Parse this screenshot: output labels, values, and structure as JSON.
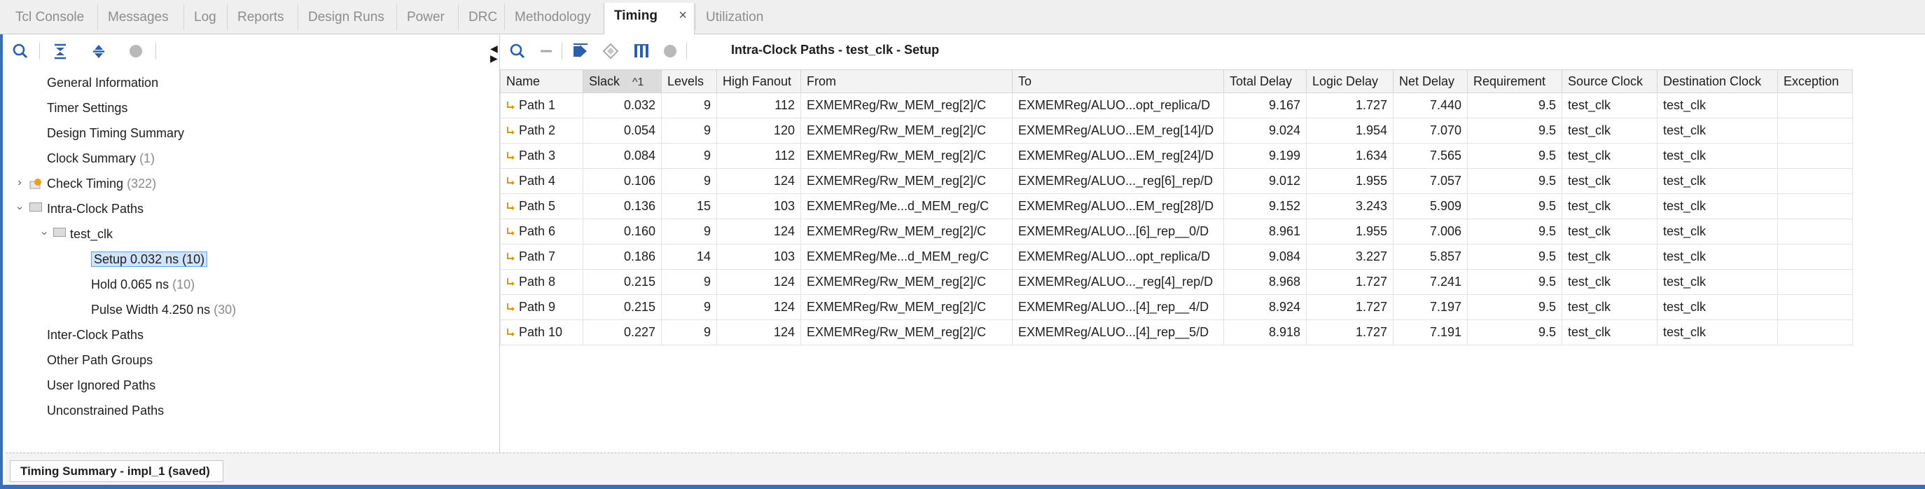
{
  "tabs": [
    {
      "label": "Tcl Console"
    },
    {
      "label": "Messages"
    },
    {
      "label": "Log"
    },
    {
      "label": "Reports"
    },
    {
      "label": "Design Runs"
    },
    {
      "label": "Power"
    },
    {
      "label": "DRC"
    },
    {
      "label": "Methodology"
    },
    {
      "label": "Timing",
      "close": "×"
    },
    {
      "label": "Utilization"
    }
  ],
  "left_toolbar": {
    "icons": [
      "search-icon",
      "collapse-all-icon",
      "expand-all-icon",
      "stop-icon"
    ]
  },
  "tree": {
    "general_info": "General Information",
    "timer_settings": "Timer Settings",
    "design_timing_summary": "Design Timing Summary",
    "clock_summary": {
      "label": "Clock Summary",
      "count": "(1)"
    },
    "check_timing": {
      "label": "Check Timing",
      "count": "(322)"
    },
    "intra_clock_paths": "Intra-Clock Paths",
    "test_clk": "test_clk",
    "setup": {
      "label": "Setup 0.032 ns (10)"
    },
    "hold": {
      "label": "Hold 0.065 ns",
      "count": "(10)"
    },
    "pulse_width": {
      "label": "Pulse Width 4.250 ns",
      "count": "(30)"
    },
    "inter_clock_paths": "Inter-Clock Paths",
    "other_path_groups": "Other Path Groups",
    "user_ignored_paths": "User Ignored Paths",
    "unconstrained_paths": "Unconstrained Paths"
  },
  "right_toolbar": {
    "icons": [
      "search-icon",
      "minus-icon",
      "export-icon",
      "diamond-icon",
      "columns-icon",
      "stop-icon"
    ],
    "title": "Intra-Clock Paths - test_clk - Setup"
  },
  "table": {
    "columns": [
      "Name",
      "Slack",
      "Levels",
      "High Fanout",
      "From",
      "To",
      "Total Delay",
      "Logic Delay",
      "Net Delay",
      "Requirement",
      "Source Clock",
      "Destination Clock",
      "Exception"
    ],
    "sort_indicator": "^1",
    "rows": [
      {
        "name": "Path 1",
        "slack": "0.032",
        "levels": "9",
        "fanout": "112",
        "from": "EXMEMReg/Rw_MEM_reg[2]/C",
        "to": "EXMEMReg/ALUO...opt_replica/D",
        "total": "9.167",
        "logic": "1.727",
        "net": "7.440",
        "req": "9.5",
        "src": "test_clk",
        "dst": "test_clk",
        "exc": ""
      },
      {
        "name": "Path 2",
        "slack": "0.054",
        "levels": "9",
        "fanout": "120",
        "from": "EXMEMReg/Rw_MEM_reg[2]/C",
        "to": "EXMEMReg/ALUO...EM_reg[14]/D",
        "total": "9.024",
        "logic": "1.954",
        "net": "7.070",
        "req": "9.5",
        "src": "test_clk",
        "dst": "test_clk",
        "exc": ""
      },
      {
        "name": "Path 3",
        "slack": "0.084",
        "levels": "9",
        "fanout": "112",
        "from": "EXMEMReg/Rw_MEM_reg[2]/C",
        "to": "EXMEMReg/ALUO...EM_reg[24]/D",
        "total": "9.199",
        "logic": "1.634",
        "net": "7.565",
        "req": "9.5",
        "src": "test_clk",
        "dst": "test_clk",
        "exc": ""
      },
      {
        "name": "Path 4",
        "slack": "0.106",
        "levels": "9",
        "fanout": "124",
        "from": "EXMEMReg/Rw_MEM_reg[2]/C",
        "to": "EXMEMReg/ALUO..._reg[6]_rep/D",
        "total": "9.012",
        "logic": "1.955",
        "net": "7.057",
        "req": "9.5",
        "src": "test_clk",
        "dst": "test_clk",
        "exc": ""
      },
      {
        "name": "Path 5",
        "slack": "0.136",
        "levels": "15",
        "fanout": "103",
        "from": "EXMEMReg/Me...d_MEM_reg/C",
        "to": "EXMEMReg/ALUO...EM_reg[28]/D",
        "total": "9.152",
        "logic": "3.243",
        "net": "5.909",
        "req": "9.5",
        "src": "test_clk",
        "dst": "test_clk",
        "exc": ""
      },
      {
        "name": "Path 6",
        "slack": "0.160",
        "levels": "9",
        "fanout": "124",
        "from": "EXMEMReg/Rw_MEM_reg[2]/C",
        "to": "EXMEMReg/ALUO...[6]_rep__0/D",
        "total": "8.961",
        "logic": "1.955",
        "net": "7.006",
        "req": "9.5",
        "src": "test_clk",
        "dst": "test_clk",
        "exc": ""
      },
      {
        "name": "Path 7",
        "slack": "0.186",
        "levels": "14",
        "fanout": "103",
        "from": "EXMEMReg/Me...d_MEM_reg/C",
        "to": "EXMEMReg/ALUO...opt_replica/D",
        "total": "9.084",
        "logic": "3.227",
        "net": "5.857",
        "req": "9.5",
        "src": "test_clk",
        "dst": "test_clk",
        "exc": ""
      },
      {
        "name": "Path 8",
        "slack": "0.215",
        "levels": "9",
        "fanout": "124",
        "from": "EXMEMReg/Rw_MEM_reg[2]/C",
        "to": "EXMEMReg/ALUO..._reg[4]_rep/D",
        "total": "8.968",
        "logic": "1.727",
        "net": "7.241",
        "req": "9.5",
        "src": "test_clk",
        "dst": "test_clk",
        "exc": ""
      },
      {
        "name": "Path 9",
        "slack": "0.215",
        "levels": "9",
        "fanout": "124",
        "from": "EXMEMReg/Rw_MEM_reg[2]/C",
        "to": "EXMEMReg/ALUO...[4]_rep__4/D",
        "total": "8.924",
        "logic": "1.727",
        "net": "7.197",
        "req": "9.5",
        "src": "test_clk",
        "dst": "test_clk",
        "exc": ""
      },
      {
        "name": "Path 10",
        "slack": "0.227",
        "levels": "9",
        "fanout": "124",
        "from": "EXMEMReg/Rw_MEM_reg[2]/C",
        "to": "EXMEMReg/ALUO...[4]_rep__5/D",
        "total": "8.918",
        "logic": "1.727",
        "net": "7.191",
        "req": "9.5",
        "src": "test_clk",
        "dst": "test_clk",
        "exc": ""
      }
    ]
  },
  "status": {
    "tab_label": "Timing Summary - impl_1 (saved)"
  },
  "colors": {
    "accent_blue": "#3b6fb5",
    "path_icon": "#d49a00",
    "selection": "#cfe3fa"
  }
}
